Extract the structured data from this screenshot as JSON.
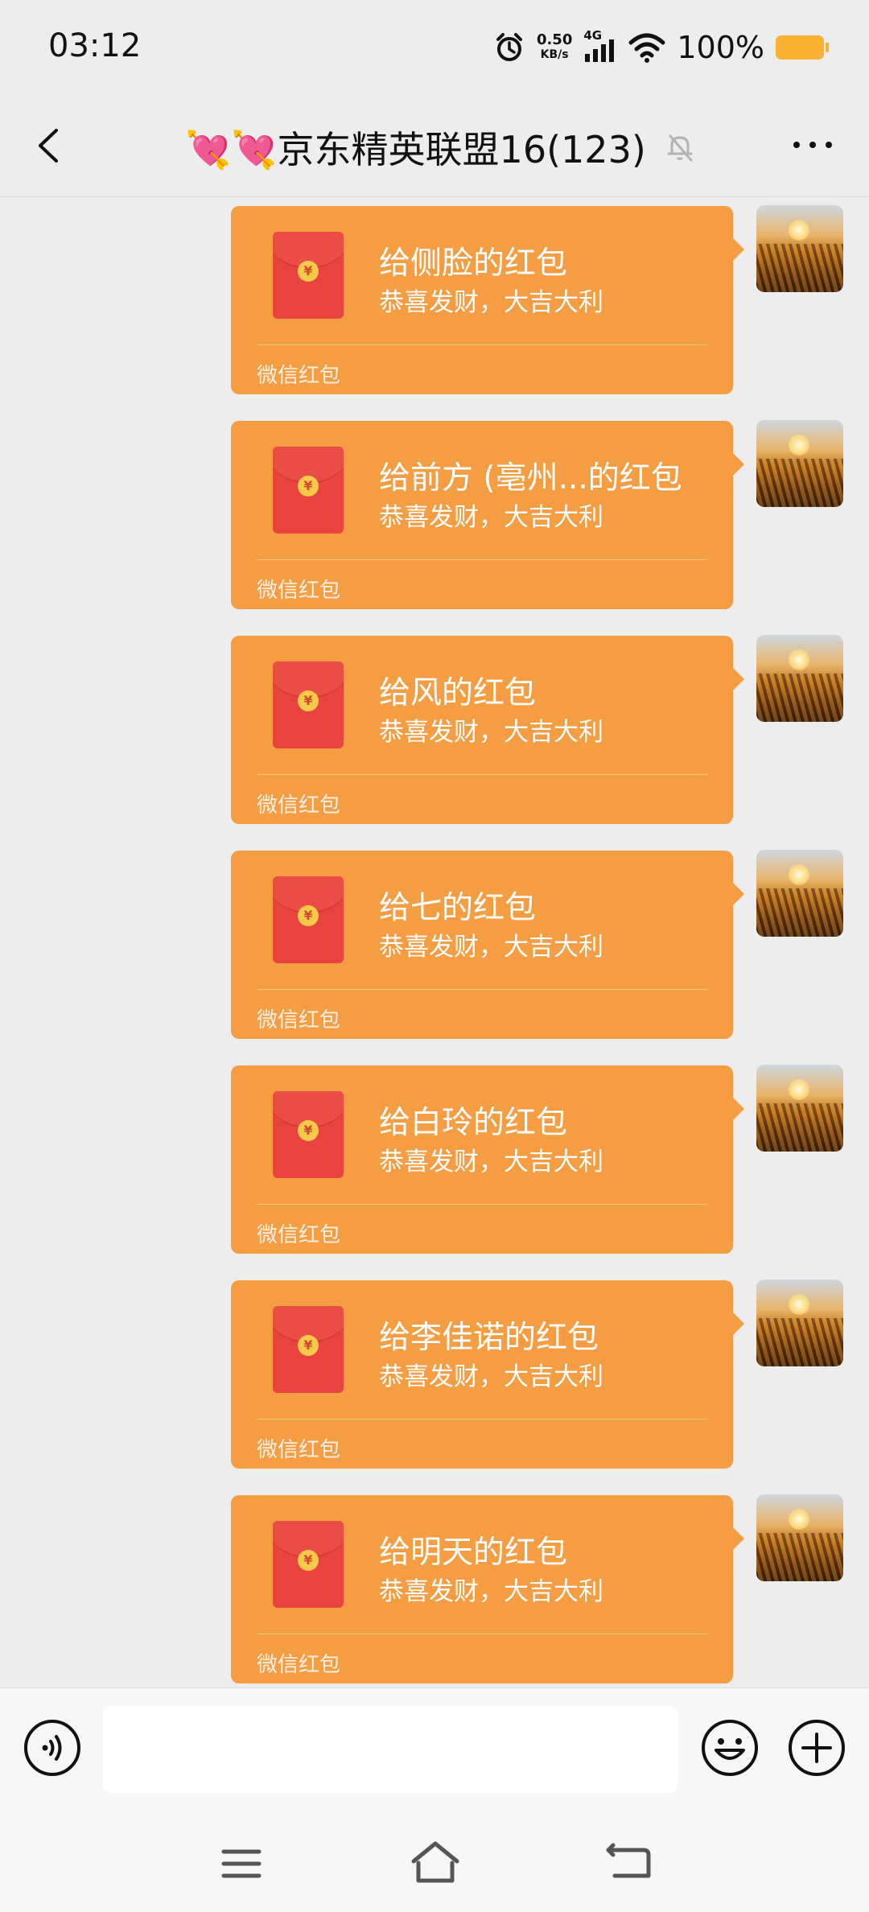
{
  "status_bar": {
    "time": "03:12",
    "net_speed_value": "0.50",
    "net_speed_unit": "KB/s",
    "network": "4G",
    "battery": "100%"
  },
  "header": {
    "title": "💘💘京东精英联盟16(123)",
    "back_icon": "chevron-left-icon",
    "mute_icon": "bell-off-icon",
    "more_icon": "more-dots-icon"
  },
  "messages": [
    {
      "title": "给侧脸的红包",
      "subtitle": "恭喜发财，大吉大利",
      "footer": "微信红包"
    },
    {
      "title": "给前方 (亳州...的红包",
      "subtitle": "恭喜发财，大吉大利",
      "footer": "微信红包"
    },
    {
      "title": "给风的红包",
      "subtitle": "恭喜发财，大吉大利",
      "footer": "微信红包"
    },
    {
      "title": "给七的红包",
      "subtitle": "恭喜发财，大吉大利",
      "footer": "微信红包"
    },
    {
      "title": "给白玲的红包",
      "subtitle": "恭喜发财，大吉大利",
      "footer": "微信红包"
    },
    {
      "title": "给李佳诺的红包",
      "subtitle": "恭喜发财，大吉大利",
      "footer": "微信红包"
    },
    {
      "title": "给明天的红包",
      "subtitle": "恭喜发财，大吉大利",
      "footer": "微信红包"
    }
  ],
  "colors": {
    "bubble": "#f59d43",
    "envelope": "#e9433f",
    "background": "#ededed"
  },
  "input_bar": {
    "voice_icon": "voice-icon",
    "emoji_icon": "emoji-icon",
    "plus_icon": "plus-icon",
    "text_value": ""
  },
  "nav_bar": {
    "menu_icon": "menu-icon",
    "home_icon": "home-icon",
    "back_icon": "back-icon"
  }
}
